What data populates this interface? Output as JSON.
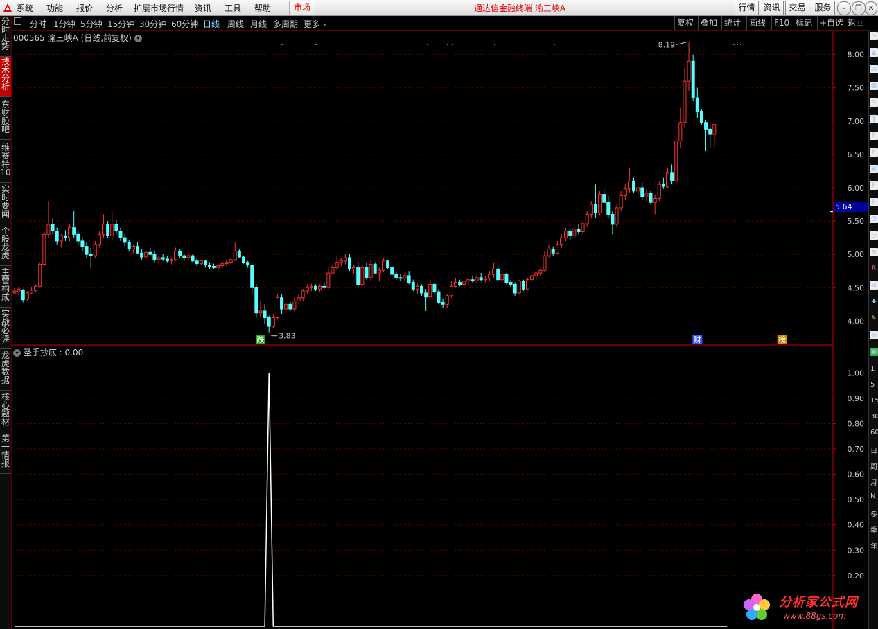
{
  "menu": [
    "系统",
    "功能",
    "报价",
    "分析",
    "扩展市场行情",
    "资讯",
    "工具",
    "帮助"
  ],
  "market_tab": "市场",
  "app_title": "通达信金融终端  渝三峡A",
  "right_buttons": [
    "行情",
    "资讯",
    "交易",
    "服务"
  ],
  "window_buttons": [
    "minimize-icon",
    "restore-icon",
    "close-icon"
  ],
  "periods": [
    "分时",
    "1分钟",
    "5分钟",
    "15分钟",
    "30分钟",
    "60分钟",
    "日线",
    "周线",
    "月线",
    "多周期",
    "更多"
  ],
  "active_period": "日线",
  "toolbar_right": [
    "复权",
    "叠加",
    "统计",
    "画线",
    "F10",
    "标记",
    "+自选",
    "返回"
  ],
  "side_tabs": [
    "分时走势",
    "技术分析",
    "东财股吧",
    "维赛特10",
    "实时要闻",
    "个股龙虎",
    "主营构成",
    "实战必读",
    "龙虎数据",
    "核心题材",
    "第一情报"
  ],
  "active_side_tab": "技术分析",
  "right_panel_texts": [
    "1",
    "5",
    "15",
    "30",
    "60",
    "日",
    "周",
    "月",
    "N",
    "多",
    "季",
    "年"
  ],
  "chart_header": "000565 渝三峡A (日线,前复权)",
  "indicator_header": "圣手抄底 : 0.00",
  "current_price": "5.64",
  "watermark": {
    "text": "分析家公式网",
    "url": "www.88gs.com"
  },
  "colors": {
    "up": "#ff3232",
    "down": "#54ffff",
    "grid": "#8b0000",
    "axis": "#c00000",
    "price_label_bg": "#00009a"
  },
  "chart_data": [
    {
      "type": "candlestick",
      "title": "000565 渝三峡A (日线,前复权)",
      "y_ticks": [
        4.0,
        4.5,
        5.0,
        5.5,
        6.0,
        6.5,
        7.0,
        7.5,
        8.0
      ],
      "ylim": [
        3.65,
        8.35
      ],
      "annotations": [
        {
          "label": "8.19",
          "kind": "max",
          "value": 8.19
        },
        {
          "label": "3.83",
          "kind": "min",
          "value": 3.83
        }
      ],
      "event_markers": [
        "跌",
        "财",
        "榜"
      ],
      "current_price": 5.64,
      "ohlc": [
        [
          4.42,
          4.5,
          4.4,
          4.45
        ],
        [
          4.44,
          4.52,
          4.38,
          4.48
        ],
        [
          4.46,
          4.48,
          4.28,
          4.32
        ],
        [
          4.33,
          4.45,
          4.3,
          4.42
        ],
        [
          4.42,
          4.5,
          4.4,
          4.46
        ],
        [
          4.46,
          4.55,
          4.44,
          4.52
        ],
        [
          4.52,
          4.88,
          4.5,
          4.85
        ],
        [
          4.85,
          5.35,
          4.8,
          5.3
        ],
        [
          5.3,
          5.8,
          5.25,
          5.45
        ],
        [
          5.45,
          5.55,
          5.3,
          5.35
        ],
        [
          5.35,
          5.4,
          5.15,
          5.2
        ],
        [
          5.2,
          5.3,
          5.1,
          5.28
        ],
        [
          5.28,
          5.36,
          5.2,
          5.25
        ],
        [
          5.25,
          5.45,
          5.2,
          5.4
        ],
        [
          5.4,
          5.65,
          5.25,
          5.3
        ],
        [
          5.3,
          5.35,
          5.15,
          5.2
        ],
        [
          5.2,
          5.25,
          5.05,
          5.12
        ],
        [
          5.12,
          5.18,
          4.95,
          5.0
        ],
        [
          5.0,
          5.1,
          4.8,
          4.98
        ],
        [
          4.98,
          5.2,
          4.95,
          5.15
        ],
        [
          5.15,
          5.35,
          5.1,
          5.3
        ],
        [
          5.3,
          5.6,
          5.25,
          5.45
        ],
        [
          5.45,
          5.5,
          5.25,
          5.28
        ],
        [
          5.28,
          5.65,
          5.22,
          5.45
        ],
        [
          5.45,
          5.52,
          5.3,
          5.35
        ],
        [
          5.35,
          5.4,
          5.2,
          5.25
        ],
        [
          5.25,
          5.3,
          5.12,
          5.18
        ],
        [
          5.18,
          5.22,
          5.05,
          5.08
        ],
        [
          5.08,
          5.15,
          5.02,
          5.12
        ],
        [
          5.12,
          5.18,
          5.0,
          5.02
        ],
        [
          5.02,
          5.08,
          4.92,
          4.96
        ],
        [
          4.96,
          5.05,
          4.94,
          5.03
        ],
        [
          5.03,
          5.1,
          4.98,
          5.0
        ],
        [
          5.0,
          5.05,
          4.88,
          4.92
        ],
        [
          4.92,
          4.98,
          4.85,
          4.95
        ],
        [
          4.95,
          5.0,
          4.9,
          4.93
        ],
        [
          4.93,
          4.98,
          4.88,
          4.9
        ],
        [
          4.9,
          4.95,
          4.85,
          4.92
        ],
        [
          4.92,
          5.1,
          4.9,
          5.05
        ],
        [
          5.05,
          5.08,
          4.95,
          4.98
        ],
        [
          4.98,
          5.0,
          4.9,
          4.95
        ],
        [
          4.95,
          5.02,
          4.92,
          4.98
        ],
        [
          4.98,
          5.0,
          4.88,
          4.9
        ],
        [
          4.9,
          4.95,
          4.82,
          4.86
        ],
        [
          4.86,
          4.92,
          4.84,
          4.9
        ],
        [
          4.9,
          4.92,
          4.8,
          4.84
        ],
        [
          4.84,
          4.88,
          4.78,
          4.82
        ],
        [
          4.82,
          4.86,
          4.78,
          4.8
        ],
        [
          4.8,
          4.85,
          4.76,
          4.83
        ],
        [
          4.83,
          4.9,
          4.8,
          4.86
        ],
        [
          4.86,
          4.92,
          4.82,
          4.88
        ],
        [
          4.88,
          4.95,
          4.85,
          4.92
        ],
        [
          4.92,
          5.18,
          4.9,
          5.05
        ],
        [
          5.05,
          5.08,
          4.94,
          4.96
        ],
        [
          4.96,
          4.98,
          4.86,
          4.88
        ],
        [
          4.88,
          4.9,
          4.8,
          4.84
        ],
        [
          4.84,
          4.86,
          4.4,
          4.5
        ],
        [
          4.5,
          4.55,
          4.05,
          4.12
        ],
        [
          4.12,
          4.3,
          4.05,
          4.15
        ],
        [
          4.15,
          4.25,
          3.95,
          4.05
        ],
        [
          4.05,
          4.08,
          3.83,
          3.92
        ],
        [
          3.92,
          4.1,
          3.9,
          4.05
        ],
        [
          4.05,
          4.4,
          4.02,
          4.35
        ],
        [
          4.35,
          4.4,
          4.1,
          4.18
        ],
        [
          4.18,
          4.28,
          4.12,
          4.25
        ],
        [
          4.25,
          4.3,
          4.15,
          4.18
        ],
        [
          4.18,
          4.35,
          4.15,
          4.3
        ],
        [
          4.3,
          4.4,
          4.25,
          4.35
        ],
        [
          4.35,
          4.48,
          4.3,
          4.45
        ],
        [
          4.45,
          4.55,
          4.4,
          4.5
        ],
        [
          4.5,
          4.56,
          4.45,
          4.52
        ],
        [
          4.52,
          4.55,
          4.45,
          4.48
        ],
        [
          4.48,
          4.55,
          4.44,
          4.52
        ],
        [
          4.52,
          4.58,
          4.48,
          4.5
        ],
        [
          4.5,
          4.8,
          4.48,
          4.72
        ],
        [
          4.72,
          4.85,
          4.7,
          4.8
        ],
        [
          4.8,
          4.98,
          4.76,
          4.88
        ],
        [
          4.88,
          4.95,
          4.82,
          4.9
        ],
        [
          4.9,
          5.0,
          4.85,
          4.95
        ],
        [
          4.95,
          5.0,
          4.75,
          4.78
        ],
        [
          4.78,
          4.85,
          4.7,
          4.8
        ],
        [
          4.8,
          4.9,
          4.5,
          4.55
        ],
        [
          4.55,
          4.85,
          4.52,
          4.8
        ],
        [
          4.8,
          4.88,
          4.62,
          4.65
        ],
        [
          4.65,
          4.92,
          4.6,
          4.85
        ],
        [
          4.85,
          4.88,
          4.7,
          4.72
        ],
        [
          4.72,
          4.8,
          4.6,
          4.76
        ],
        [
          4.76,
          4.95,
          4.74,
          4.9
        ],
        [
          4.9,
          4.92,
          4.78,
          4.8
        ],
        [
          4.8,
          4.82,
          4.68,
          4.7
        ],
        [
          4.7,
          4.75,
          4.62,
          4.65
        ],
        [
          4.65,
          4.7,
          4.6,
          4.64
        ],
        [
          4.64,
          4.72,
          4.6,
          4.68
        ],
        [
          4.68,
          4.75,
          4.55,
          4.58
        ],
        [
          4.58,
          4.62,
          4.45,
          4.48
        ],
        [
          4.48,
          4.56,
          4.4,
          4.52
        ],
        [
          4.52,
          4.55,
          4.38,
          4.42
        ],
        [
          4.42,
          4.48,
          4.15,
          4.36
        ],
        [
          4.36,
          4.62,
          4.34,
          4.55
        ],
        [
          4.55,
          4.58,
          4.4,
          4.44
        ],
        [
          4.44,
          4.48,
          4.25,
          4.28
        ],
        [
          4.28,
          4.34,
          4.2,
          4.25
        ],
        [
          4.25,
          4.4,
          4.2,
          4.38
        ],
        [
          4.38,
          4.6,
          4.35,
          4.52
        ],
        [
          4.52,
          4.65,
          4.5,
          4.58
        ],
        [
          4.58,
          4.62,
          4.52,
          4.55
        ],
        [
          4.55,
          4.62,
          4.48,
          4.6
        ],
        [
          4.6,
          4.65,
          4.55,
          4.62
        ],
        [
          4.62,
          4.68,
          4.58,
          4.6
        ],
        [
          4.6,
          4.7,
          4.57,
          4.65
        ],
        [
          4.65,
          4.72,
          4.6,
          4.62
        ],
        [
          4.62,
          4.68,
          4.58,
          4.64
        ],
        [
          4.64,
          4.75,
          4.6,
          4.7
        ],
        [
          4.7,
          4.88,
          4.65,
          4.78
        ],
        [
          4.78,
          4.85,
          4.6,
          4.62
        ],
        [
          4.62,
          4.75,
          4.58,
          4.7
        ],
        [
          4.7,
          4.72,
          4.55,
          4.58
        ],
        [
          4.58,
          4.62,
          4.5,
          4.55
        ],
        [
          4.55,
          4.58,
          4.38,
          4.42
        ],
        [
          4.42,
          4.62,
          4.4,
          4.6
        ],
        [
          4.6,
          4.62,
          4.45,
          4.48
        ],
        [
          4.48,
          4.65,
          4.46,
          4.62
        ],
        [
          4.62,
          4.72,
          4.6,
          4.68
        ],
        [
          4.68,
          4.75,
          4.62,
          4.72
        ],
        [
          4.72,
          4.78,
          4.68,
          4.76
        ],
        [
          4.76,
          5.05,
          4.74,
          4.98
        ],
        [
          4.98,
          5.15,
          4.95,
          5.08
        ],
        [
          5.08,
          5.12,
          4.98,
          5.02
        ],
        [
          5.02,
          5.2,
          5.0,
          5.15
        ],
        [
          5.15,
          5.3,
          5.1,
          5.25
        ],
        [
          5.25,
          5.4,
          5.2,
          5.35
        ],
        [
          5.35,
          5.38,
          5.22,
          5.28
        ],
        [
          5.28,
          5.42,
          5.25,
          5.38
        ],
        [
          5.38,
          5.45,
          5.3,
          5.34
        ],
        [
          5.34,
          5.5,
          5.3,
          5.46
        ],
        [
          5.46,
          5.65,
          5.42,
          5.6
        ],
        [
          5.6,
          5.8,
          5.55,
          5.75
        ],
        [
          5.75,
          6.05,
          5.55,
          5.62
        ],
        [
          5.62,
          5.95,
          5.58,
          5.9
        ],
        [
          5.9,
          5.98,
          5.75,
          5.78
        ],
        [
          5.78,
          5.88,
          5.55,
          5.6
        ],
        [
          5.6,
          5.65,
          5.3,
          5.45
        ],
        [
          5.45,
          5.75,
          5.4,
          5.7
        ],
        [
          5.7,
          5.95,
          5.65,
          5.88
        ],
        [
          5.88,
          6.05,
          5.82,
          5.98
        ],
        [
          5.98,
          6.3,
          5.92,
          6.1
        ],
        [
          6.1,
          6.15,
          5.92,
          5.95
        ],
        [
          5.95,
          6.05,
          5.85,
          6.0
        ],
        [
          6.0,
          6.08,
          5.82,
          5.86
        ],
        [
          5.86,
          5.98,
          5.8,
          5.92
        ],
        [
          5.92,
          5.96,
          5.75,
          5.78
        ],
        [
          5.78,
          5.9,
          5.6,
          5.84
        ],
        [
          5.84,
          6.1,
          5.8,
          6.05
        ],
        [
          6.05,
          6.15,
          5.98,
          6.02
        ],
        [
          6.02,
          6.3,
          6.0,
          6.22
        ],
        [
          6.22,
          6.35,
          6.05,
          6.1
        ],
        [
          6.1,
          6.75,
          6.05,
          6.7
        ],
        [
          6.7,
          7.2,
          6.6,
          6.98
        ],
        [
          6.98,
          7.8,
          6.9,
          7.6
        ],
        [
          7.6,
          8.19,
          7.45,
          7.9
        ],
        [
          7.9,
          8.0,
          7.3,
          7.35
        ],
        [
          7.35,
          7.5,
          7.05,
          7.15
        ],
        [
          7.15,
          7.18,
          6.95,
          6.98
        ],
        [
          6.98,
          7.02,
          6.55,
          6.88
        ],
        [
          6.88,
          6.95,
          6.6,
          6.8
        ],
        [
          6.8,
          6.96,
          6.6,
          6.95
        ]
      ]
    },
    {
      "type": "line",
      "title": "圣手抄底",
      "y_ticks": [
        0.2,
        0.3,
        0.4,
        0.5,
        0.6,
        0.7,
        0.8,
        0.9,
        1.0
      ],
      "ylim": [
        0,
        1.05
      ],
      "series": [
        {
          "name": "圣手抄底",
          "values": [
            0,
            0,
            0,
            0,
            0,
            0,
            0,
            0,
            0,
            0,
            0,
            0,
            0,
            0,
            0,
            0,
            0,
            0,
            0,
            0,
            0,
            0,
            0,
            0,
            0,
            0,
            0,
            0,
            0,
            0,
            0,
            0,
            0,
            0,
            0,
            0,
            0,
            0,
            0,
            0,
            0,
            0,
            0,
            0,
            0,
            0,
            0,
            0,
            0,
            0,
            0,
            0,
            0,
            0,
            0,
            0,
            0,
            0,
            0,
            0,
            1,
            0,
            0,
            0,
            0,
            0,
            0,
            0,
            0,
            0,
            0,
            0,
            0,
            0,
            0,
            0,
            0,
            0,
            0,
            0,
            0,
            0,
            0,
            0,
            0,
            0,
            0,
            0,
            0,
            0,
            0,
            0,
            0,
            0,
            0,
            0,
            0,
            0,
            0,
            0,
            0,
            0,
            0,
            0,
            0,
            0,
            0,
            0,
            0,
            0,
            0,
            0,
            0,
            0,
            0,
            0,
            0,
            0,
            0,
            0,
            0,
            0,
            0,
            0,
            0,
            0,
            0,
            0,
            0,
            0,
            0,
            0,
            0,
            0,
            0,
            0,
            0,
            0,
            0,
            0,
            0,
            0,
            0,
            0,
            0,
            0,
            0,
            0,
            0,
            0,
            0,
            0,
            0,
            0,
            0,
            0,
            0,
            0,
            0,
            0,
            0,
            0,
            0,
            0,
            0,
            0,
            0,
            0,
            0
          ]
        }
      ]
    }
  ]
}
